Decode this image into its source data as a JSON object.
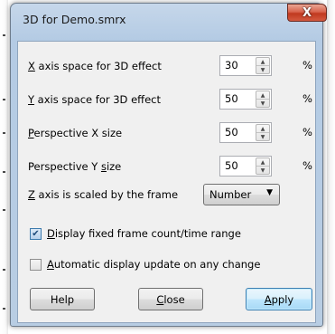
{
  "window": {
    "title": "3D for Demo.smrx",
    "close_glyph": "X"
  },
  "fields": [
    {
      "prefix": "X",
      "rest": " axis space for 3D effect",
      "value": "30",
      "unit": "%"
    },
    {
      "prefix": "Y",
      "rest": " axis space for 3D effect",
      "value": "50",
      "unit": "%"
    },
    {
      "prefix": "P",
      "rest": "erspective X size",
      "value": "50",
      "unit": "%"
    },
    {
      "pre": "Perspective Y ",
      "prefix": "s",
      "rest": "ize",
      "value": "50",
      "unit": "%"
    }
  ],
  "zscale": {
    "prefix": "Z",
    "rest": " axis is scaled by the frame",
    "selected": "Number",
    "arrow": "▼"
  },
  "options": [
    {
      "prefix": "D",
      "rest": "isplay fixed frame count/time range",
      "checked": true,
      "check_glyph": "✔"
    },
    {
      "prefix": "A",
      "rest": "utomatic display update on any change",
      "checked": false
    }
  ],
  "buttons": {
    "help": "Help",
    "close_prefix": "C",
    "close_rest": "lose",
    "apply_prefix": "A",
    "apply_rest": "pply"
  },
  "spin_glyphs": {
    "up": "▲",
    "down": "▼"
  }
}
